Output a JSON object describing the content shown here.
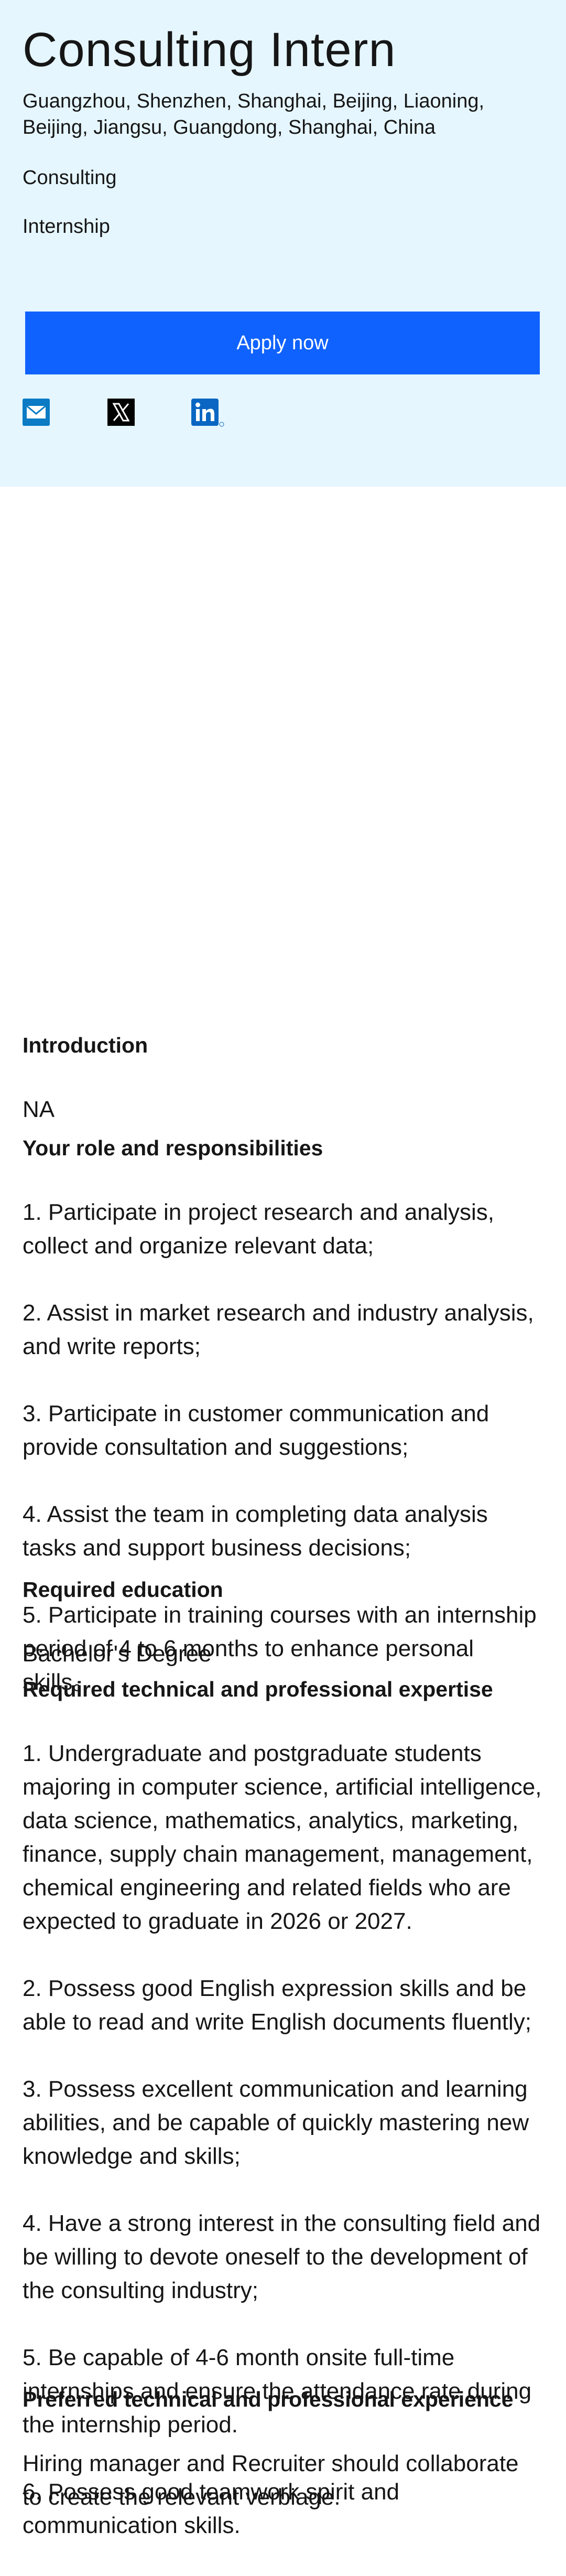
{
  "job": {
    "title": "Consulting Intern",
    "locations": "Guangzhou, Shenzhen, Shanghai, Beijing, Liaoning, Beijing, Jiangsu, Guangdong, Shanghai, China",
    "category": "Consulting",
    "type": "Internship"
  },
  "actions": {
    "apply_label": "Apply now"
  },
  "share": {
    "icons": [
      "email-icon",
      "x-icon",
      "linkedin-icon"
    ]
  },
  "colors": {
    "hero_bg": "#e5f6ff",
    "apply_bg": "#0f62fe",
    "linkedin_blue": "#0a66c2",
    "email_blue": "#0a7bc4"
  },
  "sections": {
    "introduction": {
      "heading": "Introduction",
      "lines": [
        "NA"
      ]
    },
    "responsibilities": {
      "heading": "Your role and responsibilities",
      "lines": [
        "1. Participate in project research and analysis, collect and organize relevant data;",
        "2. Assist in market research and industry analysis, and write reports;",
        "3. Participate in customer communication and provide consultation and suggestions;",
        "4. Assist the team in completing data analysis tasks and support business decisions;",
        "5. Participate in training courses with an internship period of 4 to 6 months to enhance personal skills。"
      ]
    },
    "education": {
      "heading": "Required education",
      "lines": [
        "Bachelor's Degree"
      ]
    },
    "expertise": {
      "heading": "Required technical and professional expertise",
      "lines": [
        "1. Undergraduate and postgraduate students majoring in computer science, artificial intelligence, data science, mathematics, analytics, marketing, finance, supply chain management, management, chemical engineering and related fields who are expected to graduate in 2026 or 2027.",
        "2. Possess good English expression skills and be able to read and write English documents fluently;",
        "3. Possess excellent communication and learning abilities, and be capable of quickly mastering new knowledge and skills;",
        "4. Have a strong interest in the consulting field and be willing to devote oneself to the development of the consulting industry;",
        "5. Be capable of 4-6 month onsite full-time internships and ensure the attendance rate during the internship period.",
        "6. Possess good teamwork spirit and communication skills."
      ]
    },
    "preferred": {
      "heading": "Preferred technical and professional experience",
      "lines": [
        "Hiring manager and Recruiter should collaborate to create the relevant verbiage."
      ]
    }
  }
}
